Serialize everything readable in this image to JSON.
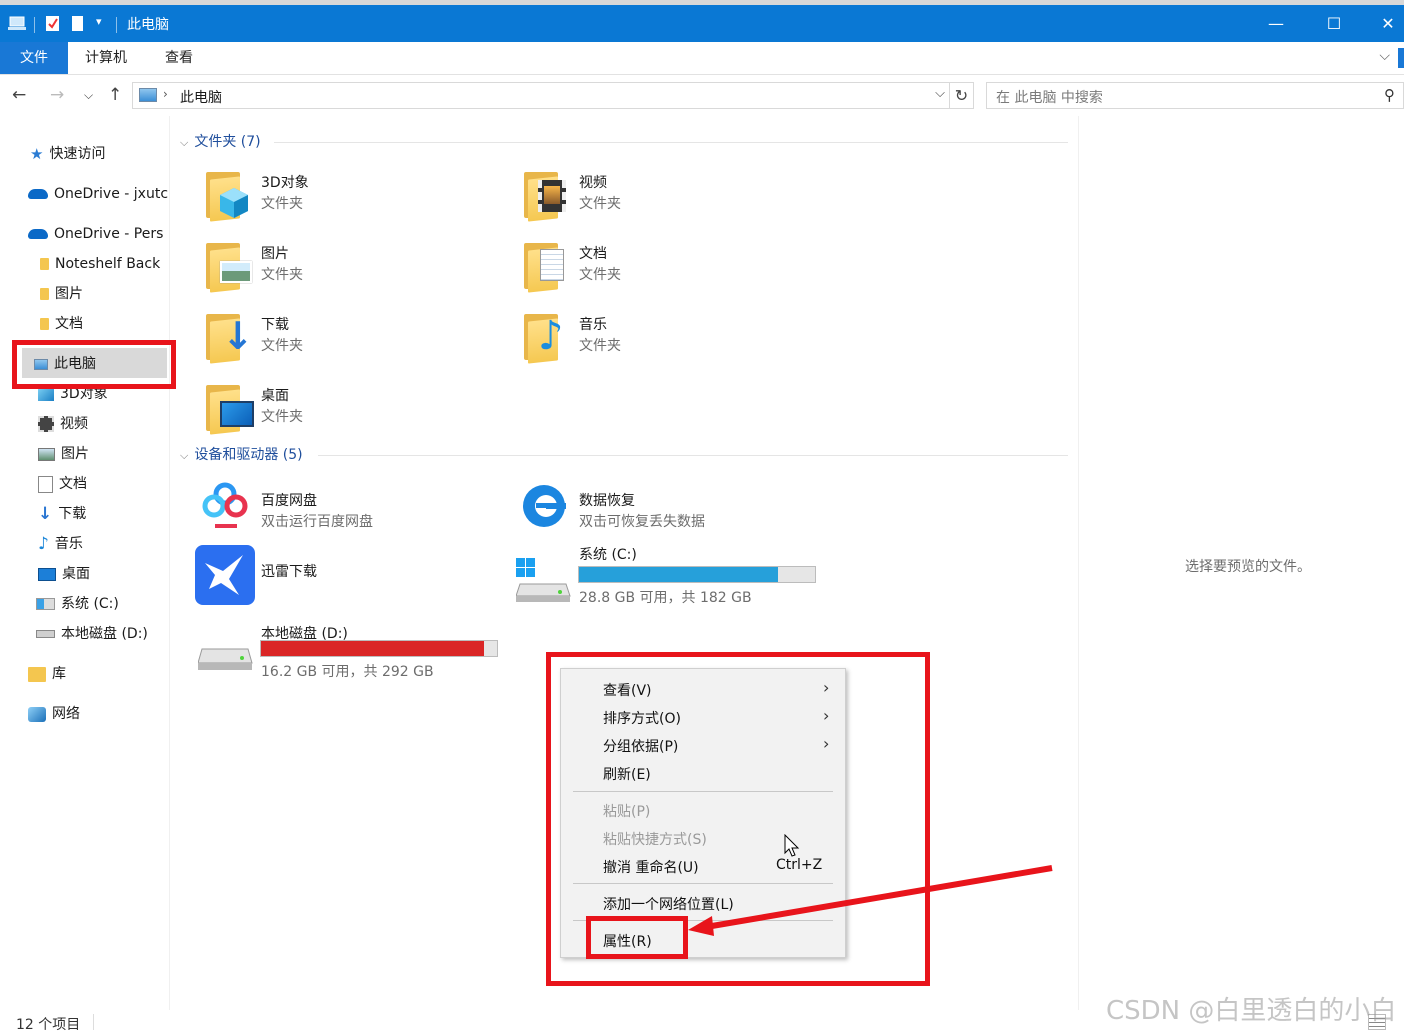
{
  "window": {
    "title": "此电脑",
    "minimize": "—",
    "maximize": "☐",
    "close": "✕"
  },
  "ribbon": {
    "tabs": [
      "文件",
      "计算机",
      "查看"
    ]
  },
  "address": {
    "crumb": "此电脑",
    "search_placeholder": "在 此电脑 中搜索"
  },
  "nav": {
    "quick_access": "快速访问",
    "onedrive1": "OneDrive - jxutc",
    "onedrive2": "OneDrive - Pers",
    "od_items": [
      "Noteshelf Back",
      "图片",
      "文档"
    ],
    "this_pc": "此电脑",
    "pc_items": [
      "3D对象",
      "视频",
      "图片",
      "文档",
      "下载",
      "音乐",
      "桌面",
      "系统 (C:)",
      "本地磁盘 (D:)"
    ],
    "library": "库",
    "network": "网络"
  },
  "content": {
    "folders_header": "文件夹 (7)",
    "folders": [
      {
        "name": "3D对象",
        "sub": "文件夹",
        "icon": "3d-objects-folder-icon"
      },
      {
        "name": "视频",
        "sub": "文件夹",
        "icon": "videos-folder-icon"
      },
      {
        "name": "图片",
        "sub": "文件夹",
        "icon": "pictures-folder-icon"
      },
      {
        "name": "文档",
        "sub": "文件夹",
        "icon": "documents-folder-icon"
      },
      {
        "name": "下载",
        "sub": "文件夹",
        "icon": "downloads-folder-icon"
      },
      {
        "name": "音乐",
        "sub": "文件夹",
        "icon": "music-folder-icon"
      },
      {
        "name": "桌面",
        "sub": "文件夹",
        "icon": "desktop-folder-icon"
      }
    ],
    "devices_header": "设备和驱动器 (5)",
    "devices": {
      "baidu": {
        "name": "百度网盘",
        "sub": "双击运行百度网盘"
      },
      "recovery": {
        "name": "数据恢复",
        "sub": "双击可恢复丢失数据"
      },
      "xunlei": {
        "name": "迅雷下载"
      },
      "c_drive": {
        "name": "系统 (C:)",
        "sub": "28.8 GB 可用，共 182 GB",
        "used_fraction": 0.842,
        "bar_color": "#26a0da"
      },
      "d_drive": {
        "name": "本地磁盘 (D:)",
        "sub": "16.2 GB 可用，共 292 GB",
        "used_fraction": 0.945,
        "bar_color": "#da2626"
      }
    }
  },
  "preview": {
    "message": "选择要预览的文件。"
  },
  "status": {
    "count": "12 个项目"
  },
  "context_menu": {
    "items": [
      {
        "label": "查看(V)",
        "submenu": true
      },
      {
        "label": "排序方式(O)",
        "submenu": true
      },
      {
        "label": "分组依据(P)",
        "submenu": true
      },
      {
        "label": "刷新(E)"
      },
      {
        "label": "粘贴(P)",
        "disabled": true
      },
      {
        "label": "粘贴快捷方式(S)",
        "disabled": true
      },
      {
        "label": "撤消 重命名(U)",
        "shortcut": "Ctrl+Z"
      },
      {
        "label": "添加一个网络位置(L)"
      },
      {
        "label": "属性(R)"
      }
    ]
  },
  "watermark": "CSDN @白里透白的小白",
  "colors": {
    "accent": "#0a78d4",
    "annotation_red": "#e8141b"
  }
}
